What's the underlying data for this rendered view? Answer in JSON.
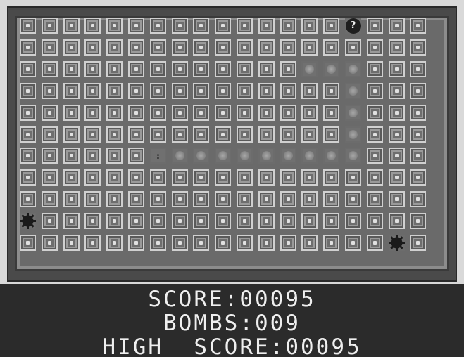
{
  "grid": {
    "columns": 19,
    "rows": 11,
    "revealed_path": [
      [
        6,
        7
      ],
      [
        6,
        8
      ],
      [
        6,
        9
      ],
      [
        6,
        10
      ],
      [
        6,
        11
      ],
      [
        6,
        12
      ],
      [
        6,
        13
      ],
      [
        6,
        14
      ],
      [
        2,
        13
      ],
      [
        2,
        14
      ],
      [
        2,
        15
      ],
      [
        3,
        15
      ],
      [
        4,
        15
      ],
      [
        5,
        15
      ],
      [
        6,
        15
      ]
    ],
    "player": [
      6,
      6
    ],
    "question": [
      0,
      15
    ],
    "mines": [
      [
        9,
        0
      ],
      [
        10,
        17
      ]
    ],
    "question_symbol": "?",
    "player_symbol": ":",
    "colors": {
      "tile": "#5a5a5a",
      "tile_border": "#d0d0d0",
      "revealed": "#8a8a8a",
      "mine": "#1a1a1a",
      "frame": "#4a4a4a"
    },
    "icons": {
      "mine": "spiked-mine-icon",
      "question": "question-mark-icon",
      "player": "player-marker-icon"
    }
  },
  "hud": {
    "score_label": "SCORE:00095",
    "bombs_label": "BOMBS:009",
    "high_score_label": "HIGH  SCORE:00095"
  }
}
